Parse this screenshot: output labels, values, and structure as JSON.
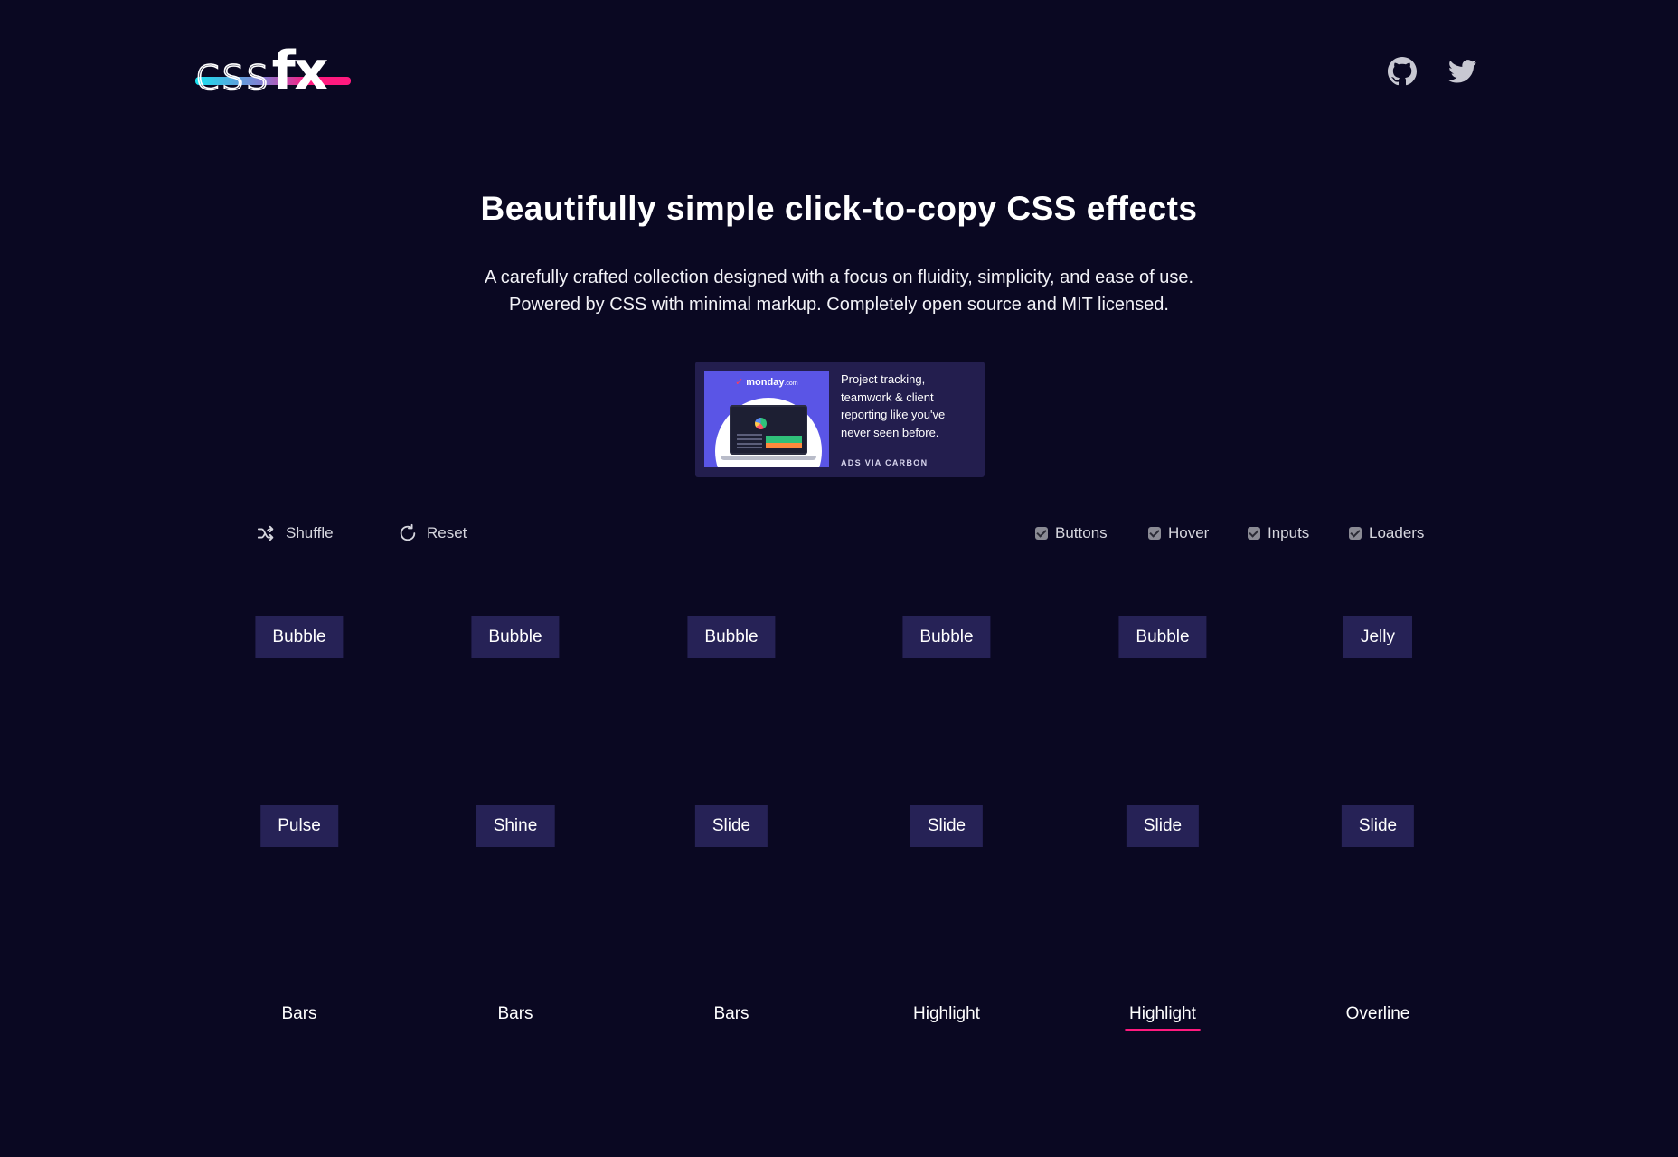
{
  "header": {
    "logo_css": "css",
    "logo_fx": "fx",
    "github_icon": "github-icon",
    "twitter_icon": "twitter-icon"
  },
  "hero": {
    "title": "Beautifully simple click-to-copy CSS effects",
    "subtitle_line1": "A carefully crafted collection designed with a focus on fluidity, simplicity, and ease of use.",
    "subtitle_line2": "Powered by CSS with minimal markup. Completely open source and MIT licensed."
  },
  "ad": {
    "brand": "monday",
    "brand_suffix": ".com",
    "text": "Project tracking, teamwork & client reporting like you've never seen before.",
    "via": "ADS VIA CARBON"
  },
  "controls": {
    "shuffle": "Shuffle",
    "reset": "Reset",
    "filters": [
      {
        "label": "Buttons",
        "checked": true
      },
      {
        "label": "Hover",
        "checked": true
      },
      {
        "label": "Inputs",
        "checked": true
      },
      {
        "label": "Loaders",
        "checked": true
      }
    ]
  },
  "effects": {
    "row1": [
      "Bubble",
      "Bubble",
      "Bubble",
      "Bubble",
      "Bubble",
      "Jelly"
    ],
    "row2": [
      "Pulse",
      "Shine",
      "Slide",
      "Slide",
      "Slide",
      "Slide"
    ],
    "row3": [
      "Bars",
      "Bars",
      "Bars",
      "Highlight",
      "Highlight",
      "Overline"
    ]
  },
  "colors": {
    "background": "#0a0822",
    "button_bg": "#262256",
    "accent_pink": "#ff1a7f",
    "accent_cyan": "#17e3f0"
  }
}
